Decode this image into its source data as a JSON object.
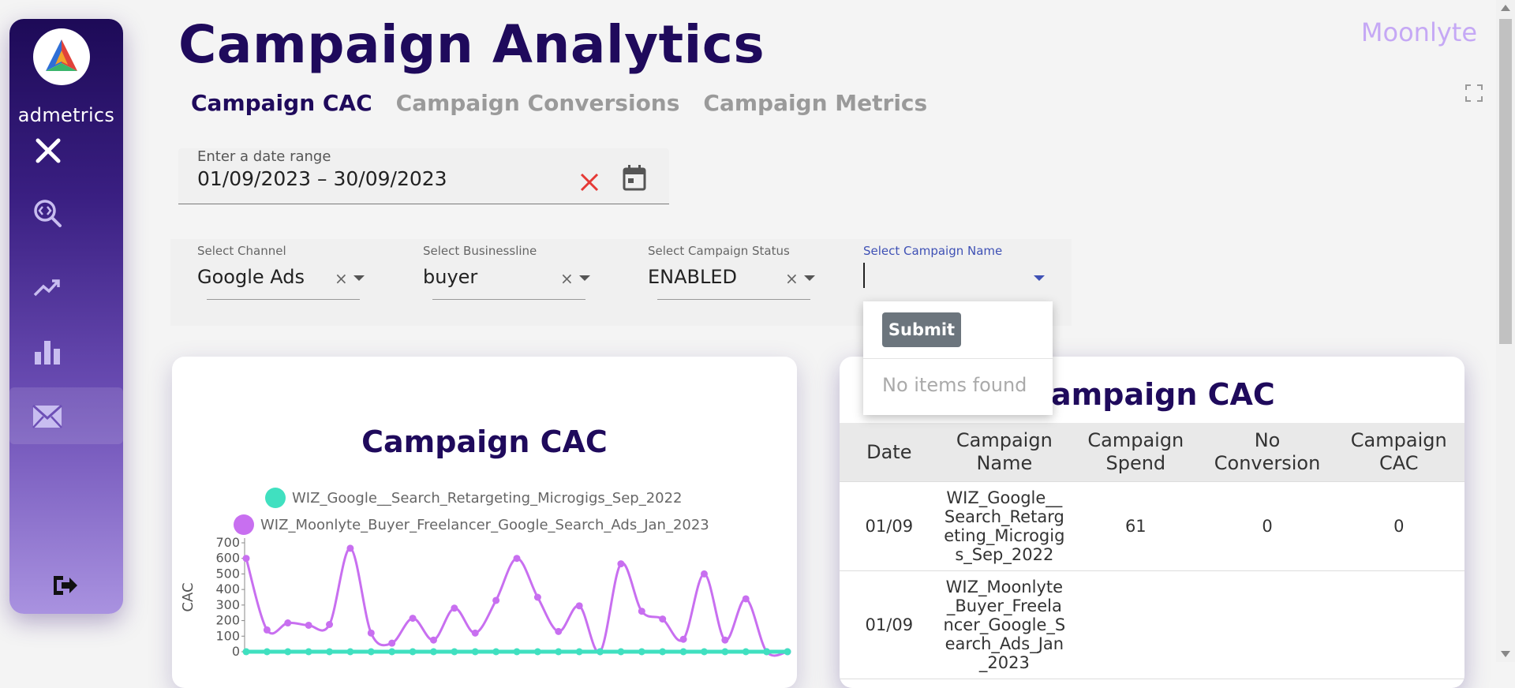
{
  "app": {
    "logo_text": "admetrics",
    "brand": "Moonlyte",
    "page_title": "Campaign Analytics"
  },
  "sidebar": {
    "items": [
      {
        "icon": "close-icon"
      },
      {
        "icon": "search-code-icon"
      },
      {
        "icon": "trending-up-icon"
      },
      {
        "icon": "bar-chart-icon"
      },
      {
        "icon": "mail-icon",
        "active": true
      },
      {
        "icon": "logout-icon"
      }
    ]
  },
  "tabs": [
    {
      "label": "Campaign CAC",
      "active": true
    },
    {
      "label": "Campaign Conversions",
      "active": false
    },
    {
      "label": "Campaign Metrics",
      "active": false
    }
  ],
  "date_range": {
    "label": "Enter a date range",
    "value": "01/09/2023 – 30/09/2023"
  },
  "filters": {
    "channel": {
      "label": "Select Channel",
      "value": "Google Ads",
      "clear": "×"
    },
    "businessline": {
      "label": "Select Businessline",
      "value": "buyer",
      "clear": "×"
    },
    "status": {
      "label": "Select Campaign Status",
      "value": "ENABLED",
      "clear": "×"
    },
    "campaign_name": {
      "label": "Select Campaign Name",
      "value": ""
    }
  },
  "dropdown": {
    "submit_label": "Submit",
    "empty_text": "No items found"
  },
  "chart_data": {
    "type": "line",
    "title": "Campaign CAC",
    "ylabel": "CAC",
    "xlabel": "",
    "ylim": [
      0,
      700
    ],
    "yticks": [
      "700",
      "600",
      "500",
      "400",
      "300",
      "200",
      "100",
      "0"
    ],
    "legend_position": "top",
    "series": [
      {
        "name": "WIZ_Google__Search_Retargeting_Microgigs_Sep_2022",
        "color": "#40e0c0",
        "values": [
          0,
          0,
          0,
          0,
          0,
          0,
          0,
          0,
          0,
          0,
          0,
          0,
          0,
          0,
          0,
          0,
          0,
          0,
          0,
          0,
          0,
          0,
          0,
          0,
          0,
          0,
          0
        ]
      },
      {
        "name": "WIZ_Moonlyte_Buyer_Freelancer_Google_Search_Ads_Jan_2023",
        "color": "#c86ff0",
        "values": [
          600,
          140,
          185,
          170,
          175,
          665,
          120,
          55,
          215,
          75,
          280,
          120,
          330,
          600,
          350,
          130,
          295,
          0,
          565,
          260,
          210,
          80,
          500,
          75,
          340,
          0,
          0
        ]
      }
    ]
  },
  "table": {
    "title": "Campaign CAC",
    "columns": [
      "Date",
      "Campaign Name",
      "Campaign Spend",
      "No Conversion",
      "Campaign CAC"
    ],
    "rows": [
      {
        "date": "01/09",
        "name": "WIZ_Google__Search_Retargeting_Microgigs_Sep_2022",
        "spend": "61",
        "no_conversion": "0",
        "cac": "0"
      },
      {
        "date": "01/09",
        "name": "WIZ_Moonlyte_Buyer_Freelancer_Google_Search_Ads_Jan_2023",
        "spend": "",
        "no_conversion": "",
        "cac": ""
      }
    ]
  },
  "colors": {
    "primary": "#1f0a5c",
    "brand": "#c5a8f5",
    "sidebar_top": "#1d0a57",
    "sidebar_bottom": "#a992e0",
    "clear_icon": "#e53935",
    "accent_blue": "#3f51b5"
  }
}
